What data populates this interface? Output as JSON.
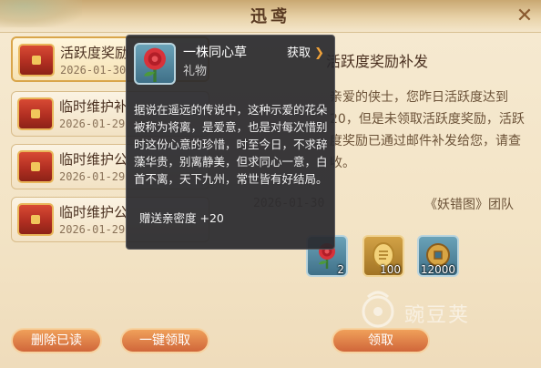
{
  "dialog": {
    "title": "迅鸢",
    "close_label": "✕"
  },
  "mail_list": [
    {
      "title": "活跃度奖励",
      "date": "2026-01-30",
      "selected": true
    },
    {
      "title": "临时维护补",
      "date": "2026-01-29",
      "selected": false
    },
    {
      "title": "临时维护公",
      "date": "2026-01-29",
      "selected": false
    },
    {
      "title": "临时维护公",
      "date": "2026-01-29",
      "selected": false
    }
  ],
  "detail": {
    "title": "活跃度奖励补发",
    "body": "亲爱的侠士，您昨日活跃度达到20，但是未领取活跃度奖励，活跃度奖励已通过邮件补发给您，请查收。",
    "date": "2026-01-30",
    "signature": "《妖错图》团队",
    "rewards": [
      {
        "name": "rose-reward",
        "count": "2",
        "style": "blue"
      },
      {
        "name": "token-reward",
        "count": "100",
        "style": "gold"
      },
      {
        "name": "coin-reward",
        "count": "12000",
        "style": "blue"
      }
    ]
  },
  "buttons": {
    "delete_read": "删除已读",
    "claim_all": "一键领取",
    "claim": "领取"
  },
  "tooltip": {
    "item_name": "一株同心草",
    "item_type": "礼物",
    "acquire_label": "获取",
    "acquire_arrow": "❯",
    "description": "据说在遥远的传说中，这种示爱的花朵被称为将离，是爱意，也是对每次惜别时这份心意的珍惜，时至今日，不求辞藻华贵，别离静美，但求同心一意，白首不离，天下九州，常世皆有好结局。",
    "bonus": "赠送亲密度 +20"
  },
  "watermark": {
    "text": "豌豆荚"
  },
  "colors": {
    "parchment": "#f3e4c6",
    "accent_orange": "#d0663a",
    "tooltip_bg": "#28282c",
    "chest_red": "#b22f22"
  }
}
